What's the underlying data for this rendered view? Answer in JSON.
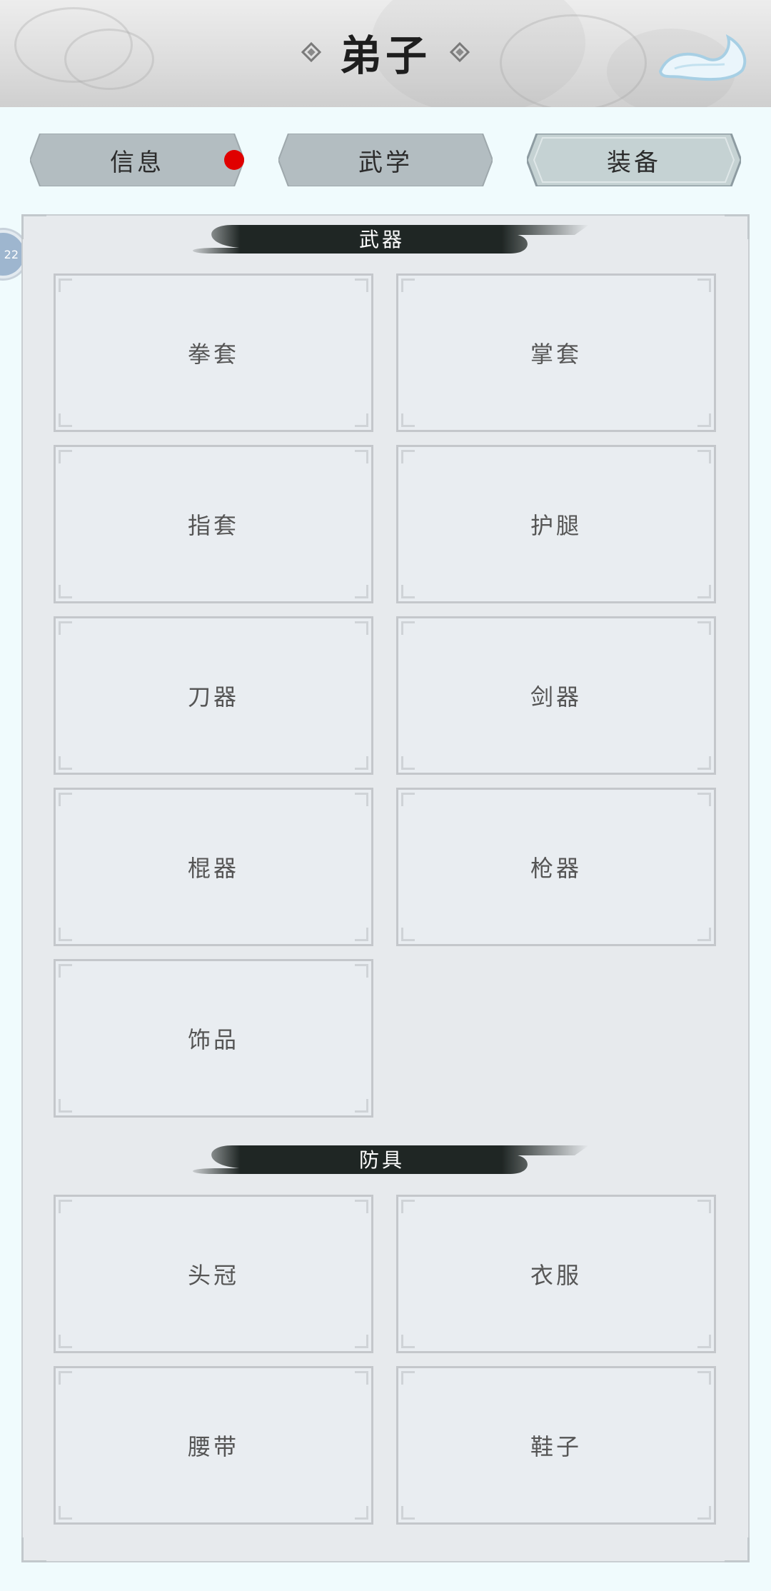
{
  "header": {
    "title": "弟子",
    "back_icon": "cloud-back-icon"
  },
  "tabs": [
    {
      "label": "信息",
      "selected": false,
      "badge": "red-dot"
    },
    {
      "label": "武学",
      "selected": false
    },
    {
      "label": "装备",
      "selected": true
    }
  ],
  "side_badge": {
    "text": "22"
  },
  "sections": {
    "weapons": {
      "title": "武器",
      "slots": [
        "拳套",
        "掌套",
        "指套",
        "护腿",
        "刀器",
        "剑器",
        "棍器",
        "枪器",
        "饰品"
      ]
    },
    "armor": {
      "title": "防具",
      "slots": [
        "头冠",
        "衣服",
        "腰带",
        "鞋子"
      ]
    }
  },
  "colors": {
    "page_bg": "#f0fbfd",
    "tab_bg": "#b3bdc1",
    "tab_selected_bg": "#c5d2d3",
    "badge_red": "#e00000",
    "section_header": "#1f2624"
  }
}
